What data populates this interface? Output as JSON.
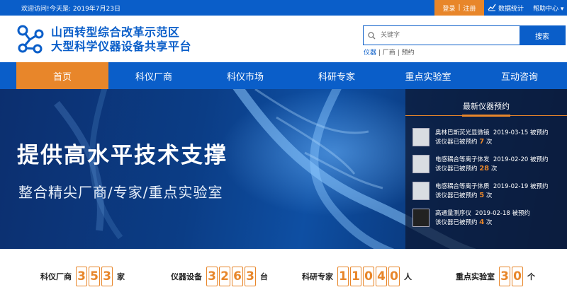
{
  "topbar": {
    "welcome": "欢迎访问!",
    "today": "今天是: 2019年7月23日",
    "login": "登录",
    "separator": "|",
    "register": "注册",
    "stats_label": "数据统计",
    "help_label": "帮助中心"
  },
  "header": {
    "title_line1": "山西转型综合改革示范区",
    "title_line2": "大型科学仪器设备共享平台",
    "search_placeholder": "关键字",
    "search_button": "搜索",
    "quick_links": [
      "仪器",
      "厂商",
      "预约"
    ]
  },
  "nav": {
    "items": [
      "首页",
      "科仪厂商",
      "科仪市场",
      "科研专家",
      "重点实验室",
      "互动咨询"
    ]
  },
  "banner": {
    "headline": "提供高水平技术支撑",
    "subline": "整合精尖厂商/专家/重点实验室"
  },
  "bookings": {
    "title": "最新仪器预约",
    "items": [
      {
        "name": "奥林巴斯荧光显微镜",
        "date": "2019-03-15",
        "suffix": "被预约",
        "prefix": "该仪器已被预约",
        "count": "7",
        "unit": "次"
      },
      {
        "name": "电感耦合等离子体发",
        "date": "2019-02-20",
        "suffix": "被预约",
        "prefix": "该仪器已被预约",
        "count": "28",
        "unit": "次"
      },
      {
        "name": "电感耦合等离子体质",
        "date": "2019-02-19",
        "suffix": "被预约",
        "prefix": "该仪器已被预约",
        "count": "5",
        "unit": "次"
      },
      {
        "name": "高通量测序仪",
        "date": "2019-02-18",
        "suffix": "被预约",
        "prefix": "该仪器已被预约",
        "count": "4",
        "unit": "次"
      }
    ]
  },
  "stats": {
    "manufacturers": {
      "label": "科仪厂商",
      "digits": [
        "3",
        "5",
        "3"
      ],
      "unit": "家"
    },
    "instruments": {
      "label": "仪器设备",
      "digits": [
        "3",
        "2",
        "6",
        "3"
      ],
      "unit": "台"
    },
    "experts": {
      "label": "科研专家",
      "digits": [
        "1",
        "1",
        "0",
        "4",
        "0"
      ],
      "unit": "人"
    },
    "labs": {
      "label": "重点实验室",
      "digits": [
        "3",
        "0"
      ],
      "unit": "个"
    }
  },
  "colors": {
    "brand_blue": "#0a5ec9",
    "accent_orange": "#e8862a"
  }
}
